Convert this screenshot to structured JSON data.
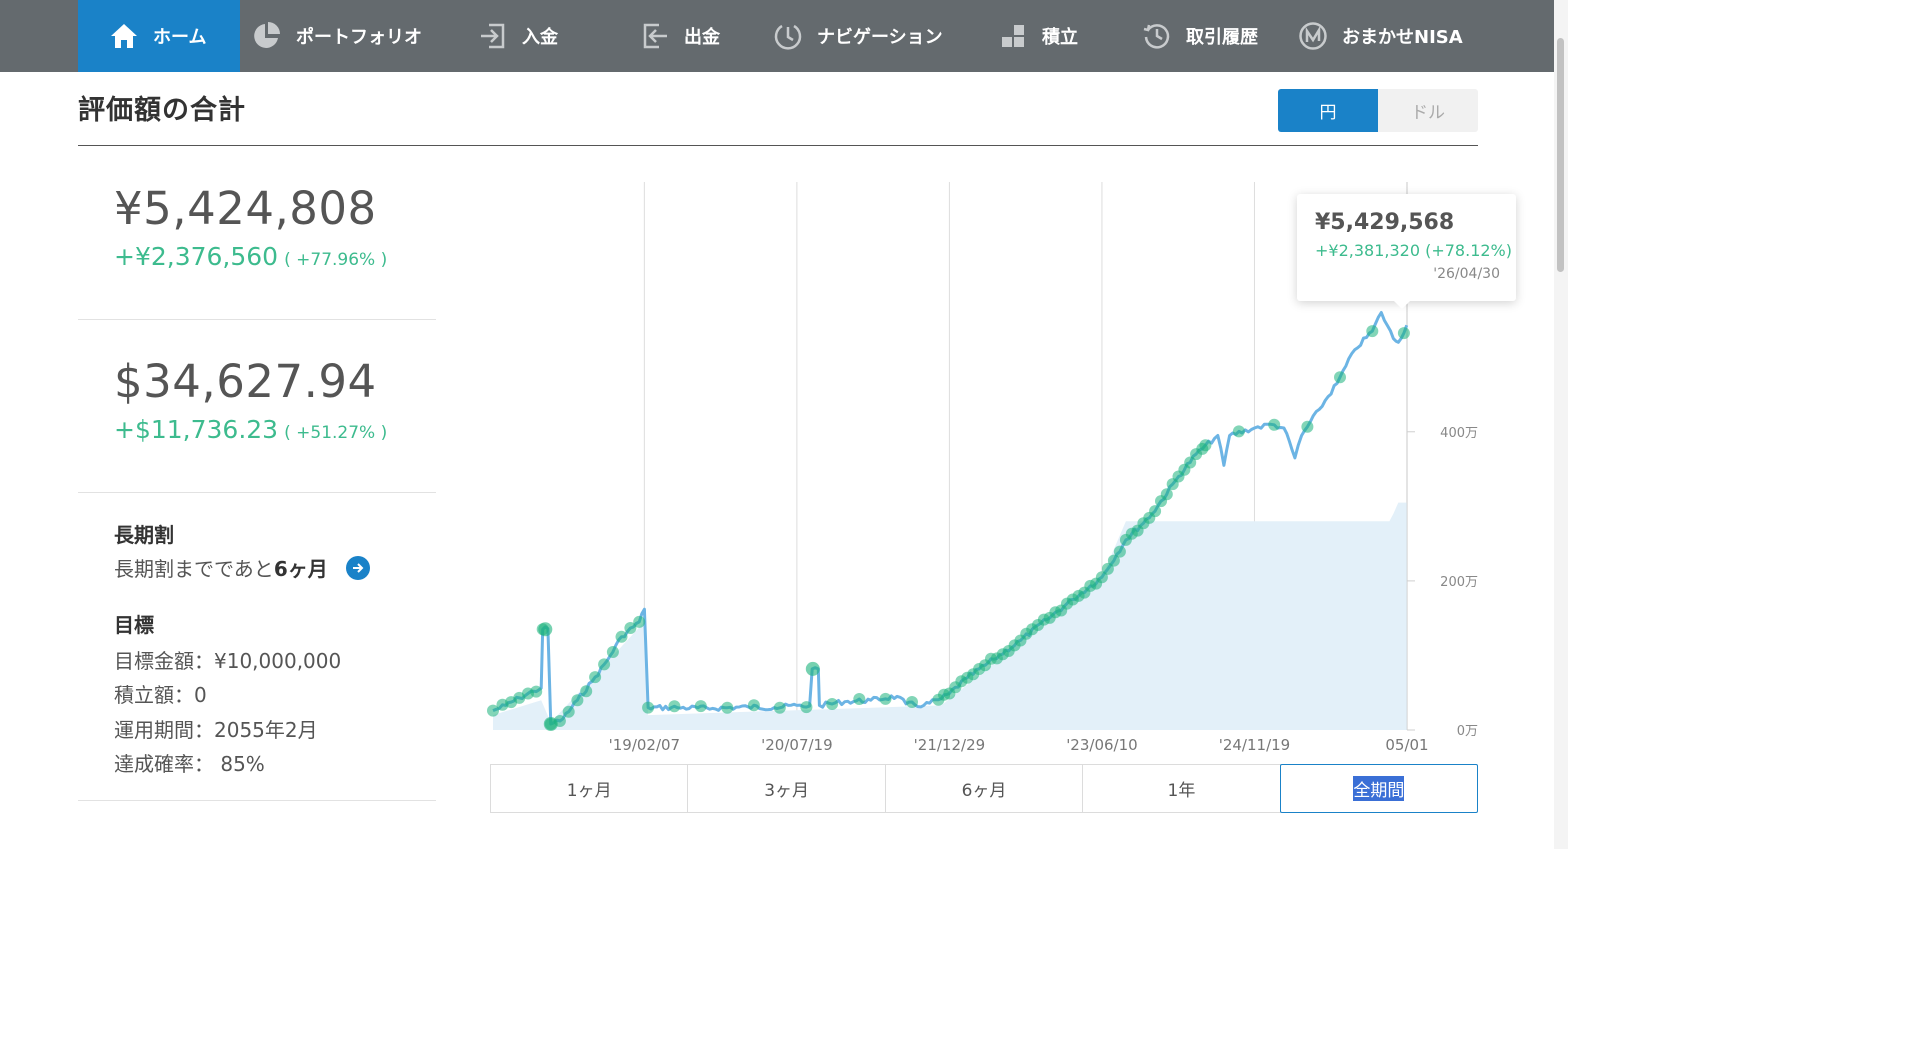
{
  "nav": {
    "items": [
      {
        "label": "ホーム",
        "icon": "home-icon",
        "active": true
      },
      {
        "label": "ポートフォリオ",
        "icon": "pie-chart-icon"
      },
      {
        "label": "入金",
        "icon": "deposit-icon"
      },
      {
        "label": "出金",
        "icon": "withdraw-icon"
      },
      {
        "label": "ナビゲーション",
        "icon": "navigation-icon"
      },
      {
        "label": "積立",
        "icon": "blocks-icon"
      },
      {
        "label": "取引履歴",
        "icon": "history-icon"
      },
      {
        "label": "おまかせNISA",
        "icon": "nisa-icon"
      }
    ],
    "colors": {
      "bar": "#646a6e",
      "active": "#1a82c8"
    }
  },
  "header": {
    "title": "評価額の合計",
    "currency_toggle": {
      "yen": "円",
      "usd": "ドル",
      "selected": "円"
    }
  },
  "summary": {
    "yen": {
      "total": "¥5,424,808",
      "gain": "+¥2,376,560",
      "pct": "( +77.96% )"
    },
    "usd": {
      "total": "$34,627.94",
      "gain": "+$11,736.23",
      "pct": "( +51.27% )"
    }
  },
  "long_term": {
    "heading": "長期割",
    "text_prefix": "長期割までであと",
    "text_bold": "6ヶ月"
  },
  "goal": {
    "heading": "目標",
    "lines": [
      "目標金額：¥10,000,000",
      "積立額：0",
      "運用期間：2055年2月",
      "達成確率： 85%"
    ]
  },
  "tooltip": {
    "value": "¥5,429,568",
    "gain": "+¥2,381,320 (+78.12%)",
    "date": "'26/04/30"
  },
  "period_tabs": {
    "items": [
      "1ヶ月",
      "3ヶ月",
      "6ヶ月",
      "1年",
      "全期間"
    ],
    "selected": "全期間"
  },
  "colors": {
    "gain": "#3dbb8e",
    "line": "#6cb4e4",
    "area": "#e3f0f9",
    "dot": "#1bb37c"
  },
  "chart_data": {
    "type": "line",
    "x_ticks": [
      "'19/02/07",
      "'20/07/19",
      "'21/12/29",
      "'23/06/10",
      "'24/11/19",
      "05/01"
    ],
    "y_ticks": [
      "0万",
      "200万",
      "400万"
    ],
    "ylim": [
      0,
      7350000
    ],
    "x_range": [
      "2017-09-01",
      "2026-05-01"
    ],
    "series": [
      {
        "kind": "value",
        "points": [
          [
            "2017-09-01",
            260000
          ],
          [
            "2017-10-15",
            330000
          ],
          [
            "2017-12-01",
            430000
          ],
          [
            "2018-01-20",
            520000
          ],
          [
            "2018-02-15",
            560000
          ],
          [
            "2018-02-20",
            1350000
          ],
          [
            "2018-03-10",
            1360000
          ],
          [
            "2018-03-20",
            80000
          ],
          [
            "2018-05-01",
            150000
          ],
          [
            "2018-06-20",
            400000
          ],
          [
            "2018-08-10",
            650000
          ],
          [
            "2018-10-01",
            930000
          ],
          [
            "2018-11-20",
            1250000
          ],
          [
            "2019-01-20",
            1450000
          ],
          [
            "2019-02-07",
            1620000
          ],
          [
            "2019-02-20",
            300000
          ],
          [
            "2019-06-01",
            300000
          ],
          [
            "2019-10-01",
            290000
          ],
          [
            "2020-02-01",
            310000
          ],
          [
            "2020-05-01",
            300000
          ],
          [
            "2020-07-19",
            330000
          ],
          [
            "2020-09-01",
            320000
          ],
          [
            "2020-09-10",
            820000
          ],
          [
            "2020-10-01",
            820000
          ],
          [
            "2020-10-05",
            330000
          ],
          [
            "2021-01-01",
            380000
          ],
          [
            "2021-04-01",
            400000
          ],
          [
            "2021-07-01",
            450000
          ],
          [
            "2021-08-01",
            350000
          ],
          [
            "2021-10-01",
            330000
          ],
          [
            "2021-12-01",
            420000
          ],
          [
            "2021-12-29",
            490000
          ],
          [
            "2022-03-01",
            700000
          ],
          [
            "2022-06-01",
            950000
          ],
          [
            "2022-09-01",
            1200000
          ],
          [
            "2022-12-01",
            1480000
          ],
          [
            "2023-03-01",
            1750000
          ],
          [
            "2023-06-10",
            2050000
          ],
          [
            "2023-09-01",
            2550000
          ],
          [
            "2023-12-01",
            2900000
          ],
          [
            "2024-03-01",
            3400000
          ],
          [
            "2024-05-01",
            3700000
          ],
          [
            "2024-07-15",
            3950000
          ],
          [
            "2024-08-05",
            3550000
          ],
          [
            "2024-08-25",
            3950000
          ],
          [
            "2024-11-19",
            4050000
          ],
          [
            "2025-01-15",
            4100000
          ],
          [
            "2025-03-01",
            4050000
          ],
          [
            "2025-04-08",
            3650000
          ],
          [
            "2025-05-01",
            3950000
          ],
          [
            "2025-07-01",
            4300000
          ],
          [
            "2025-09-01",
            4650000
          ],
          [
            "2025-11-01",
            5100000
          ],
          [
            "2026-01-01",
            5350000
          ],
          [
            "2026-02-01",
            5600000
          ],
          [
            "2026-03-15",
            5250000
          ],
          [
            "2026-04-01",
            5200000
          ],
          [
            "2026-04-30",
            5430000
          ]
        ]
      },
      {
        "kind": "contribution",
        "points": [
          [
            "2017-09-01",
            200000
          ],
          [
            "2018-02-15",
            400000
          ],
          [
            "2018-03-20",
            100000
          ],
          [
            "2019-02-07",
            1450000
          ],
          [
            "2019-02-20",
            200000
          ],
          [
            "2021-12-01",
            330000
          ],
          [
            "2023-06-10",
            2050000
          ],
          [
            "2023-09-01",
            2800000
          ],
          [
            "2026-03-01",
            2800000
          ],
          [
            "2026-03-15",
            2900000
          ],
          [
            "2026-04-01",
            3050000
          ],
          [
            "2026-04-30",
            3050000
          ]
        ]
      }
    ]
  }
}
